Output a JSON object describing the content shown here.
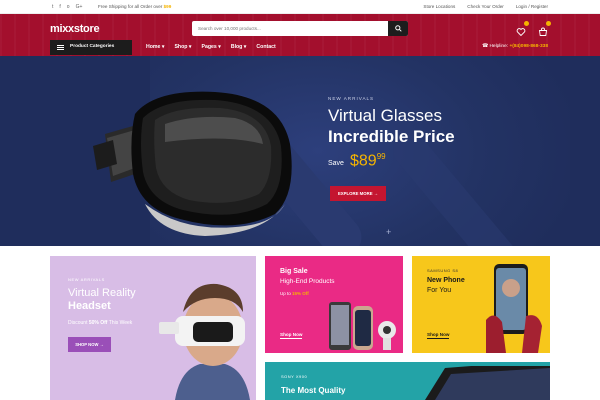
{
  "topbar": {
    "social_icons": [
      "twitter-icon",
      "facebook-icon",
      "instagram-icon",
      "google-plus-icon"
    ],
    "social_glyphs": [
      "t",
      "f",
      "o",
      "G+"
    ],
    "shipping_prefix": "Free Shipping for all Order over",
    "shipping_amount": "$99",
    "links": [
      "Store Locations",
      "Check Your Order",
      "Login / Register"
    ]
  },
  "header": {
    "logo": "mixxstore",
    "search_placeholder": "Search over 10,000 products...",
    "categories_button": "Product Categories",
    "nav": [
      "Home ▾",
      "Shop ▾",
      "Pages ▾",
      "Blog ▾",
      "Contact"
    ],
    "helpline_label": "Helpline:",
    "helpline_number": "+(84)098-868-338"
  },
  "hero": {
    "eyebrow": "NEW ARRIVALS",
    "title_line1": "Virtual Glasses",
    "title_line2": "Incredible Price",
    "save_label": "Save",
    "price": "$89",
    "price_cents": "99",
    "button": "EXPLORE MORE →"
  },
  "promos": {
    "vr": {
      "eyebrow": "NEW ARRIVALS",
      "title1": "Virtual Reality",
      "title2": "Headset",
      "discount_prefix": "Discount",
      "discount_value": "50% Off",
      "discount_suffix": "This Week",
      "button": "SHOP NOW →"
    },
    "sale": {
      "title1": "Big Sale",
      "title2": "High-End Products",
      "offer_prefix": "Up to",
      "offer_value": "15% Off",
      "link": "Shop Now"
    },
    "phone": {
      "eyebrow": "SAMSUNG S8",
      "title1": "New Phone",
      "title2": "For You",
      "link": "Shop Now"
    },
    "tv": {
      "eyebrow": "SONY X900",
      "title": "The Most Quality"
    }
  },
  "colors": {
    "header_red": "#a30f2d",
    "hero_navy": "#1f2d5c",
    "accent_yellow": "#f5b400",
    "button_red": "#c41530"
  }
}
